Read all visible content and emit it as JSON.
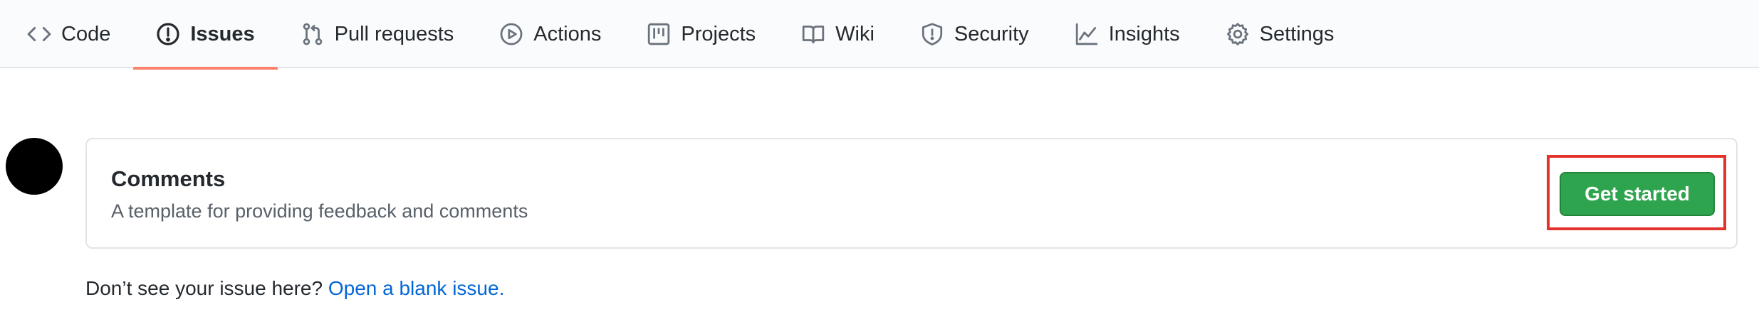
{
  "tabs": [
    {
      "label": "Code",
      "icon": "code-icon"
    },
    {
      "label": "Issues",
      "icon": "issue-opened-icon",
      "selected": true
    },
    {
      "label": "Pull requests",
      "icon": "git-pull-request-icon"
    },
    {
      "label": "Actions",
      "icon": "play-icon"
    },
    {
      "label": "Projects",
      "icon": "project-icon"
    },
    {
      "label": "Wiki",
      "icon": "book-icon"
    },
    {
      "label": "Security",
      "icon": "shield-icon"
    },
    {
      "label": "Insights",
      "icon": "graph-icon"
    },
    {
      "label": "Settings",
      "icon": "gear-icon"
    }
  ],
  "template": {
    "title": "Comments",
    "description": "A template for providing feedback and comments",
    "button_label": "Get started"
  },
  "footer": {
    "prompt": "Don’t see your issue here?",
    "link": "Open a blank issue."
  },
  "colors": {
    "selected_tab_underline": "#f9826c",
    "primary_button": "#2ea44f",
    "link": "#0366d6",
    "highlight_box": "#e3312b"
  }
}
